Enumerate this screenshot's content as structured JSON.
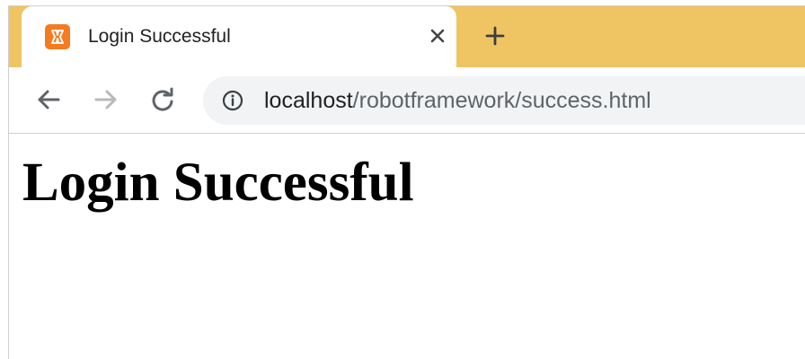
{
  "browser": {
    "tab": {
      "title": "Login Successful",
      "favicon": "xampp-favicon-icon",
      "favicon_color": "#f47b20"
    },
    "tabstrip_color": "#efc564",
    "toolbar": {
      "back_icon": "back-arrow-icon",
      "forward_icon": "forward-arrow-icon",
      "reload_icon": "reload-icon",
      "site_info_icon": "info-icon"
    },
    "address_bar": {
      "host": "localhost",
      "path": "/robotframework/success.html"
    }
  },
  "page": {
    "heading": "Login Successful"
  }
}
